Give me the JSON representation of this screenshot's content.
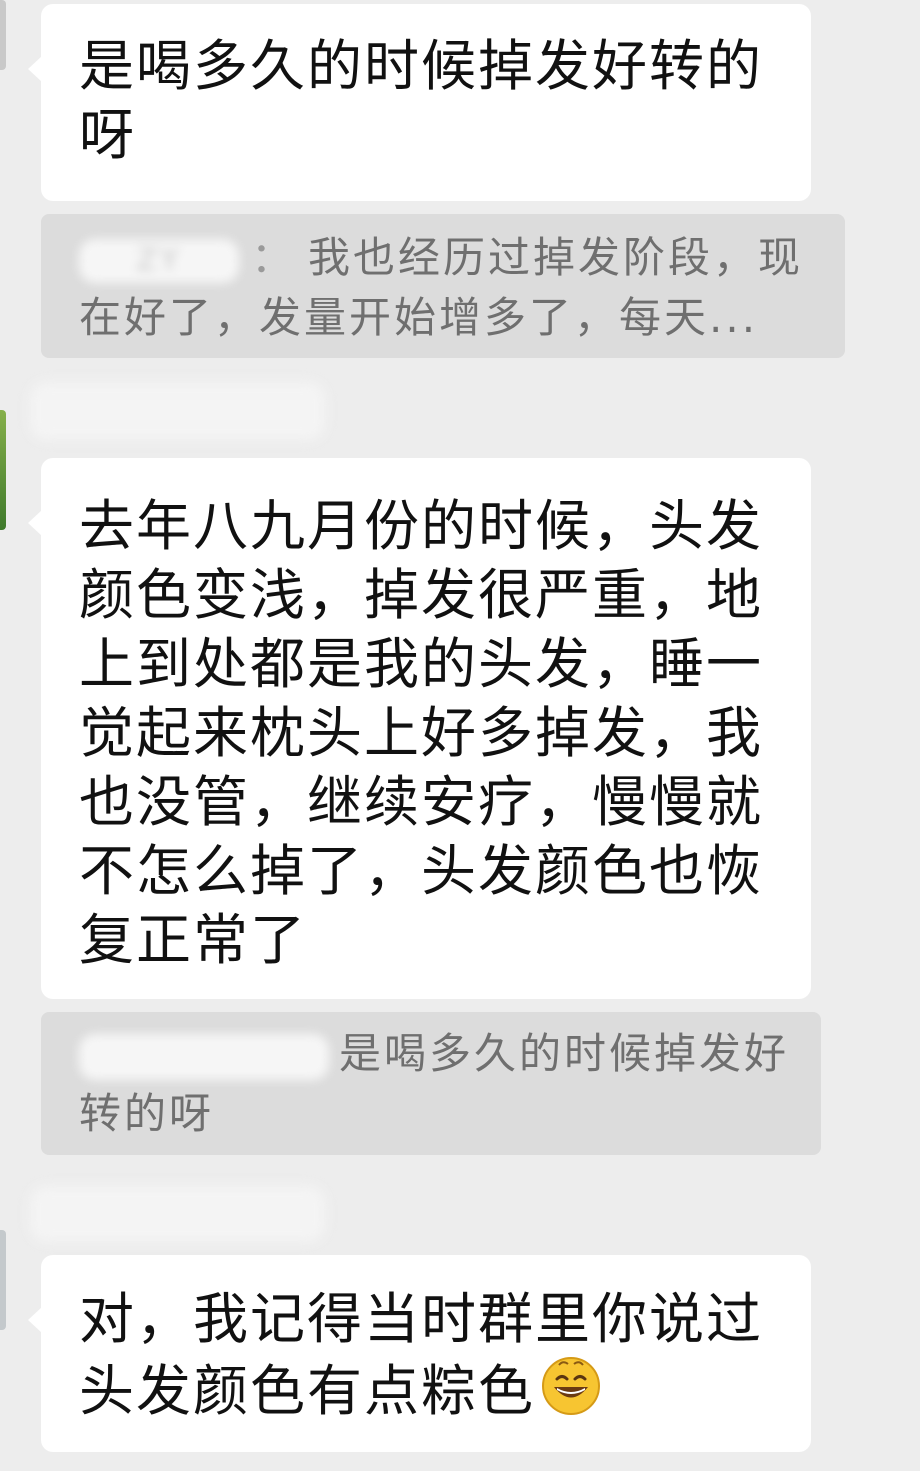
{
  "messages": [
    {
      "text": "是喝多久的时候掉发好转的呀"
    },
    {
      "quote": {
        "sender": "ZY",
        "text": "我也经历过掉发阶段，现在好了，发量开始增多了，每天..."
      }
    },
    {
      "text": "去年八九月份的时候，头发颜色变浅，掉发很严重，地上到处都是我的头发，睡一觉起来枕头上好多掉发，我也没管，继续安疗，慢慢就不怎么掉了，头发颜色也恢复正常了"
    },
    {
      "quote": {
        "text": "是喝多久的时候掉发好转的呀"
      }
    },
    {
      "text": "对，我记得当时群里你说过头发颜色有点粽色",
      "emoji": "grinning-face-icon"
    }
  ],
  "colors": {
    "background": "#ededed",
    "bubble": "#ffffff",
    "quote_background": "#dcdcdc",
    "quote_text": "#6f6f6f",
    "message_text": "#111111"
  }
}
